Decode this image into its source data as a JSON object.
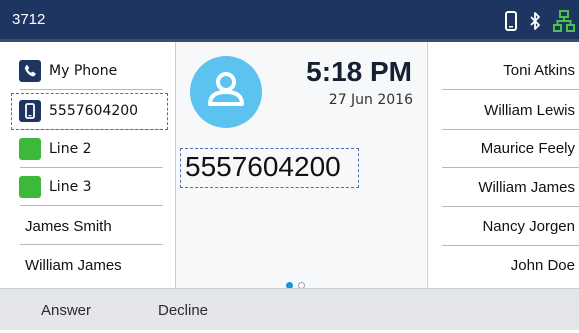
{
  "status_bar": {
    "extension": "3712",
    "icons": [
      "phone-icon",
      "bluetooth-icon",
      "network-icon"
    ],
    "icon_colors": {
      "phone": "#ffffff",
      "bluetooth": "#ffffff",
      "network": "#4cc24a"
    }
  },
  "left_keys": [
    {
      "label": "My Phone",
      "icon": "phone-handset-icon"
    },
    {
      "label": "5557604200",
      "icon": "mobile-phone-icon"
    },
    {
      "label": "Line 2",
      "icon": "line-status-icon",
      "status_color": "#3db83a"
    },
    {
      "label": "Line 3",
      "icon": "line-status-icon",
      "status_color": "#3db83a"
    },
    {
      "label": "James Smith"
    },
    {
      "label": "William James"
    }
  ],
  "center": {
    "time": "5:18 PM",
    "date": "27 Jun 2016",
    "caller_number": "5557604200",
    "page_current": 1,
    "page_count": 2,
    "accent_color": "#1e8fdc"
  },
  "right_keys": [
    {
      "label": "Toni Atkins"
    },
    {
      "label": "William Lewis"
    },
    {
      "label": "Maurice Feely"
    },
    {
      "label": "William James"
    },
    {
      "label": "Nancy Jorgen"
    },
    {
      "label": "John Doe"
    }
  ],
  "softkeys": {
    "answer": "Answer",
    "decline": "Decline"
  }
}
